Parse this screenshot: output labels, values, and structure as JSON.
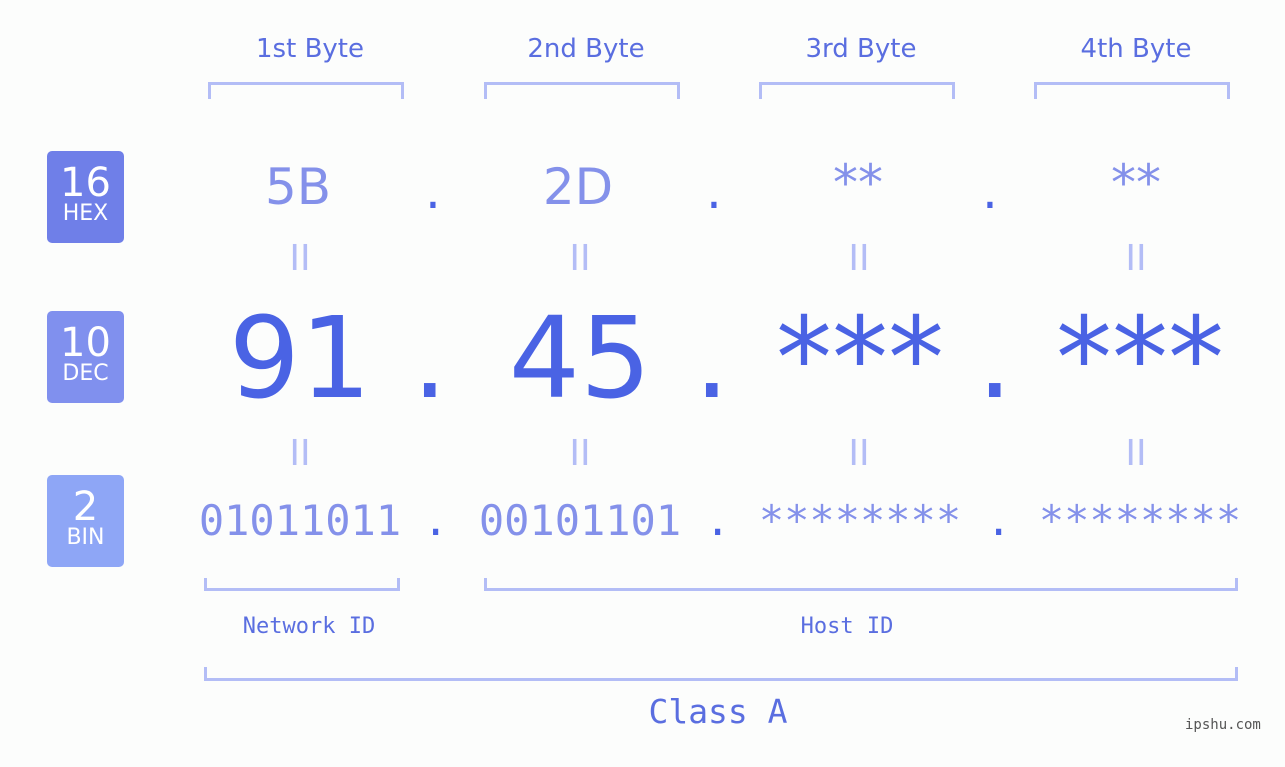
{
  "badges": [
    {
      "number": "16",
      "label": "HEX",
      "color": "#6f7fe8"
    },
    {
      "number": "10",
      "label": "DEC",
      "color": "#8090ee"
    },
    {
      "number": "2",
      "label": "BIN",
      "color": "#8ea6f6"
    }
  ],
  "byte_headers": [
    "1st Byte",
    "2nd Byte",
    "3rd Byte",
    "4th Byte"
  ],
  "hex": [
    "5B",
    "2D",
    "**",
    "**"
  ],
  "dec": [
    "91",
    "45",
    "***",
    "***"
  ],
  "bin": [
    "01011011",
    "00101101",
    "********",
    "********"
  ],
  "separator": ".",
  "equals": "II",
  "network_id_label": "Network ID",
  "host_id_label": "Host ID",
  "class_label": "Class A",
  "watermark": "ipshu.com",
  "colors": {
    "accent": "#4a63e4",
    "light": "#8491ea",
    "bracket": "#b3bdf6"
  }
}
